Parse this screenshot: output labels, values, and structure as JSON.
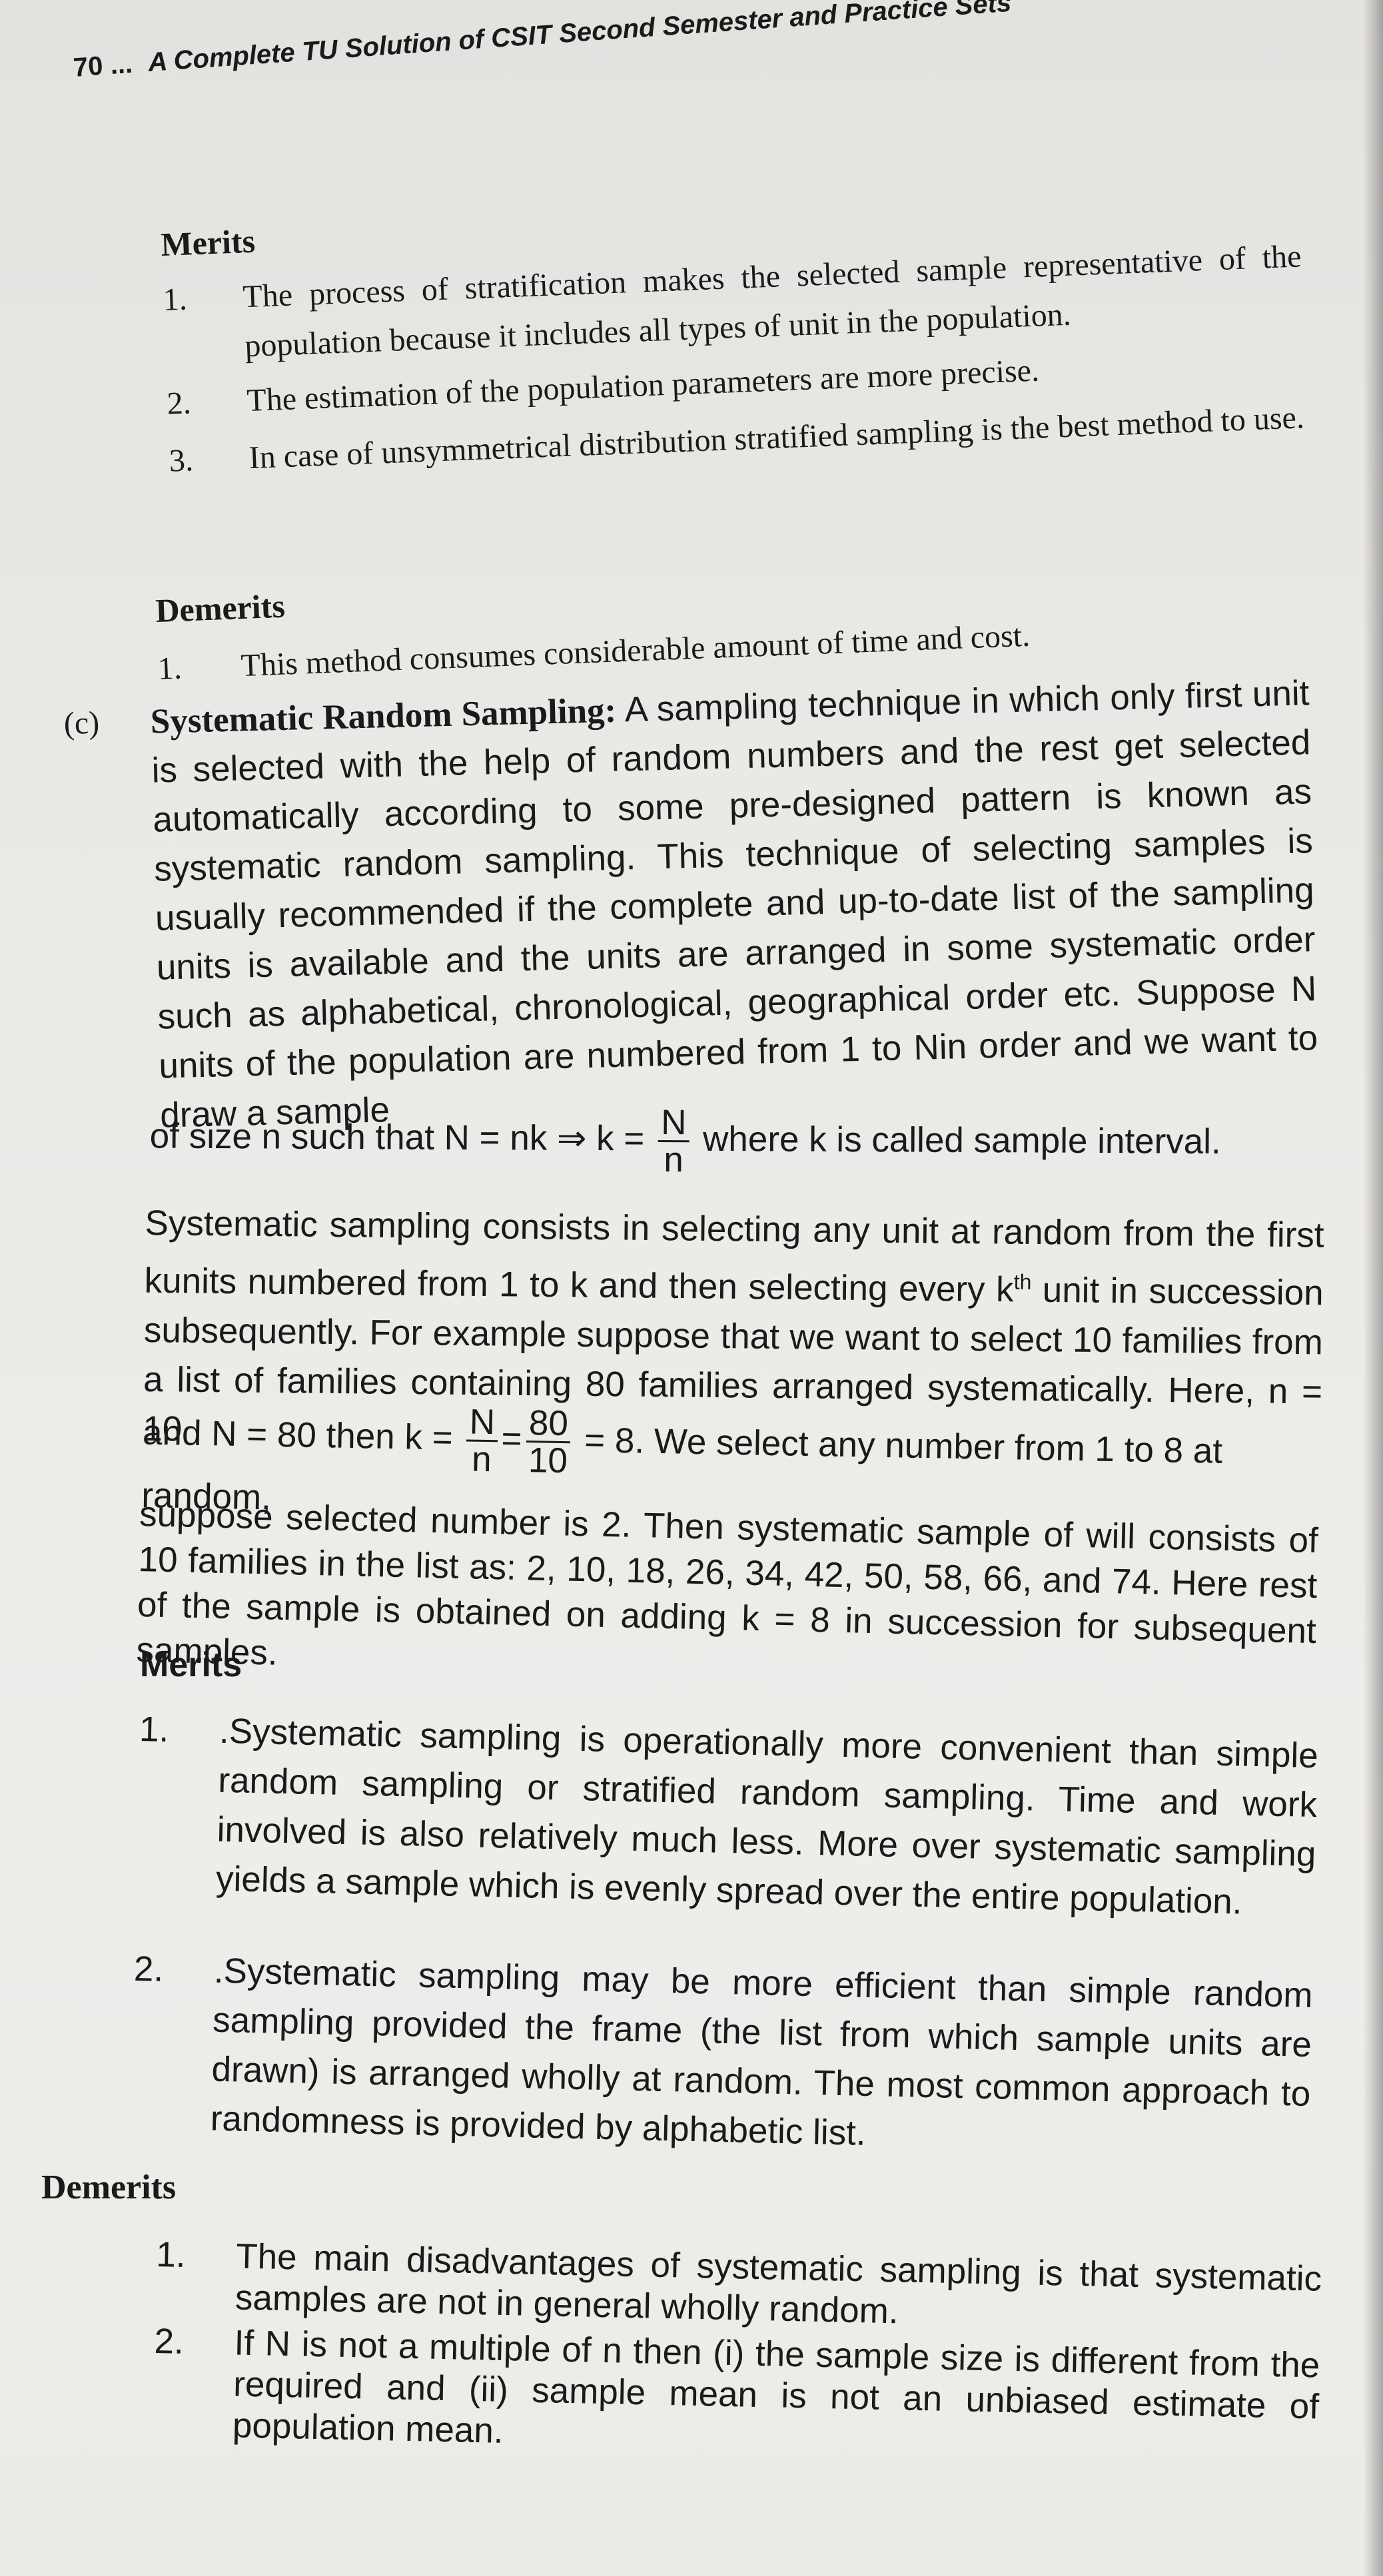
{
  "header": {
    "page_number": "70 ...",
    "title": "A Complete TU Solution of CSIT Second Semester and Practice Sets"
  },
  "stratified_merits": {
    "heading": "Merits",
    "items": [
      {
        "num": "1.",
        "text": "The process of stratification makes the selected sample representative of the population because it includes all types of unit in the population."
      },
      {
        "num": "2.",
        "text": "The estimation of the population parameters are more precise."
      },
      {
        "num": "3.",
        "text": "In case of unsymmetrical distribution stratified sampling is the best method to use."
      }
    ]
  },
  "stratified_demerits": {
    "heading": "Demerits",
    "items": [
      {
        "num": "1.",
        "text": "This method consumes considerable amount of time and cost."
      }
    ]
  },
  "systematic": {
    "label": "(c)",
    "title": "Systematic Random Sampling:",
    "para1": "A sampling technique in which only first unit is selected with the help of random numbers and the rest get selected automatically according to some pre-designed pattern is known as systematic random sampling. This technique of selecting samples is usually recommended if the complete and up-to-date list of the sampling units is available and the units are arranged in some systematic order such as alphabetical, chronological, geographical order etc. Suppose N units of the population are numbered from 1 to Nin order and we want to draw a sample",
    "formula_prefix": "of size n such that N = nk ⇒ k =",
    "formula_num": "N",
    "formula_den": "n",
    "formula_suffix": "where k is called sample interval.",
    "para2_a": "Systematic sampling consists in selecting any unit at random from the first kunits numbered from 1 to k and then selecting every k",
    "para2_sup": "th",
    "para2_b": "unit in succession subsequently. For example suppose that we want to select 10 families from a list of families containing 80 families arranged systematically. Here, n = 10",
    "example_prefix": "and N = 80 then k =",
    "example_f1_num": "N",
    "example_f1_den": "n",
    "example_eq": "=",
    "example_f2_num": "80",
    "example_f2_den": "10",
    "example_suffix": "= 8. We select any number from 1 to 8 at random,",
    "para3": "suppose selected number is 2. Then systematic sample of will consists of 10 families in the list as: 2, 10, 18, 26, 34, 42, 50, 58, 66, and 74. Here rest of the sample is obtained on adding k = 8 in succession for subsequent samples."
  },
  "systematic_merits": {
    "heading": "Merits",
    "items": [
      {
        "num": "1.",
        "text": ".Systematic sampling is operationally more convenient than simple random sampling or stratified random sampling. Time and work involved is also relatively much less. More over systematic sampling yields a sample which is evenly spread over the entire population."
      },
      {
        "num": "2.",
        "text": ".Systematic sampling may be more efficient than simple random sampling provided the frame (the list from which sample units are drawn) is arranged wholly at random. The most common approach to randomness is provided by alphabetic list."
      }
    ]
  },
  "systematic_demerits": {
    "heading": "Demerits",
    "items": [
      {
        "num": "1.",
        "text": "The main disadvantages of systematic sampling is that systematic samples are not in general wholly random."
      },
      {
        "num": "2.",
        "text": "If N is not a multiple of n then (i) the sample size is different from the required and (ii) sample mean is not an unbiased estimate of population mean."
      }
    ]
  }
}
